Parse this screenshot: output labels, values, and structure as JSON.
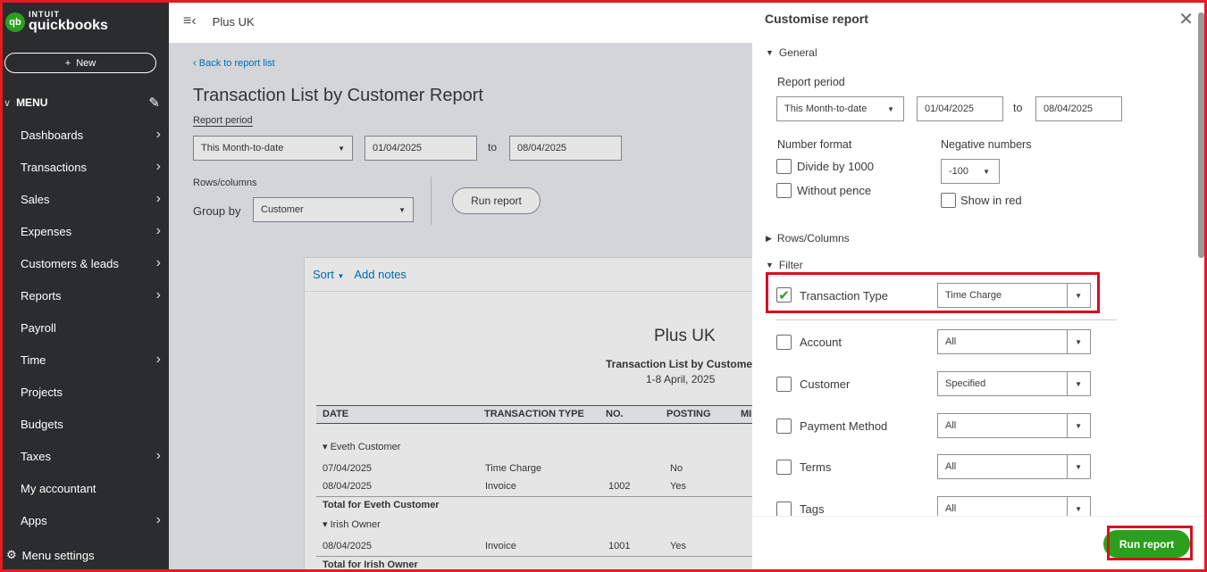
{
  "app": {
    "logo_brand": "intuit",
    "logo_product": "quickbooks",
    "company_name": "Plus UK"
  },
  "sidebar": {
    "new_label": "New",
    "menu_label": "MENU",
    "items": [
      {
        "label": "Dashboards",
        "has_arrow": true
      },
      {
        "label": "Transactions",
        "has_arrow": true
      },
      {
        "label": "Sales",
        "has_arrow": true
      },
      {
        "label": "Expenses",
        "has_arrow": true
      },
      {
        "label": "Customers & leads",
        "has_arrow": true
      },
      {
        "label": "Reports",
        "has_arrow": true
      },
      {
        "label": "Payroll",
        "has_arrow": false
      },
      {
        "label": "Time",
        "has_arrow": true
      },
      {
        "label": "Projects",
        "has_arrow": false
      },
      {
        "label": "Budgets",
        "has_arrow": false
      },
      {
        "label": "Taxes",
        "has_arrow": true
      },
      {
        "label": "My accountant",
        "has_arrow": false
      },
      {
        "label": "Apps",
        "has_arrow": true
      }
    ],
    "settings_label": "Menu settings"
  },
  "main": {
    "back_link": "Back to report list",
    "title": "Transaction List by Customer Report",
    "report_period_label": "Report period",
    "period_value": "This Month-to-date",
    "date_from": "01/04/2025",
    "to_label": "to",
    "date_to": "08/04/2025",
    "rows_columns_label": "Rows/columns",
    "group_by_label": "Group by",
    "group_by_value": "Customer",
    "run_report": "Run report"
  },
  "report": {
    "sort_label": "Sort",
    "add_notes": "Add notes",
    "company": "Plus UK",
    "subtitle": "Transaction List by Customer",
    "date_range": "1-8 April, 2025",
    "columns": [
      "DATE",
      "TRANSACTION TYPE",
      "NO.",
      "POSTING",
      "MI"
    ],
    "groups": [
      {
        "name": "Eveth Customer",
        "rows": [
          {
            "date": "07/04/2025",
            "type": "Time Charge",
            "no": "",
            "posting": "No"
          },
          {
            "date": "08/04/2025",
            "type": "Invoice",
            "no": "1002",
            "posting": "Yes"
          }
        ],
        "total": "Total for Eveth Customer"
      },
      {
        "name": "Irish Owner",
        "rows": [
          {
            "date": "08/04/2025",
            "type": "Invoice",
            "no": "1001",
            "posting": "Yes"
          }
        ],
        "total": "Total for Irish Owner"
      }
    ]
  },
  "panel": {
    "title": "Customise report",
    "general_label": "General",
    "report_period_label": "Report period",
    "period_value": "This Month-to-date",
    "date_from": "01/04/2025",
    "to_label": "to",
    "date_to": "08/04/2025",
    "number_format_label": "Number format",
    "divide_label": "Divide by 1000",
    "without_pence_label": "Without pence",
    "negative_numbers_label": "Negative numbers",
    "negative_value": "-100",
    "show_in_red_label": "Show in red",
    "rows_columns_label": "Rows/Columns",
    "filter_label": "Filter",
    "filters": [
      {
        "label": "Transaction Type",
        "checked": true,
        "value": "Time Charge"
      },
      {
        "label": "Account",
        "checked": false,
        "value": "All"
      },
      {
        "label": "Customer",
        "checked": false,
        "value": "Specified"
      },
      {
        "label": "Payment Method",
        "checked": false,
        "value": "All"
      },
      {
        "label": "Terms",
        "checked": false,
        "value": "All"
      },
      {
        "label": "Tags",
        "checked": false,
        "value": "All"
      }
    ],
    "run_report": "Run report"
  },
  "colors": {
    "brand_green": "#2ca01c",
    "sidebar_bg": "#2b2c2e",
    "link_blue": "#0077c5",
    "highlight_red": "#d80f1f"
  }
}
